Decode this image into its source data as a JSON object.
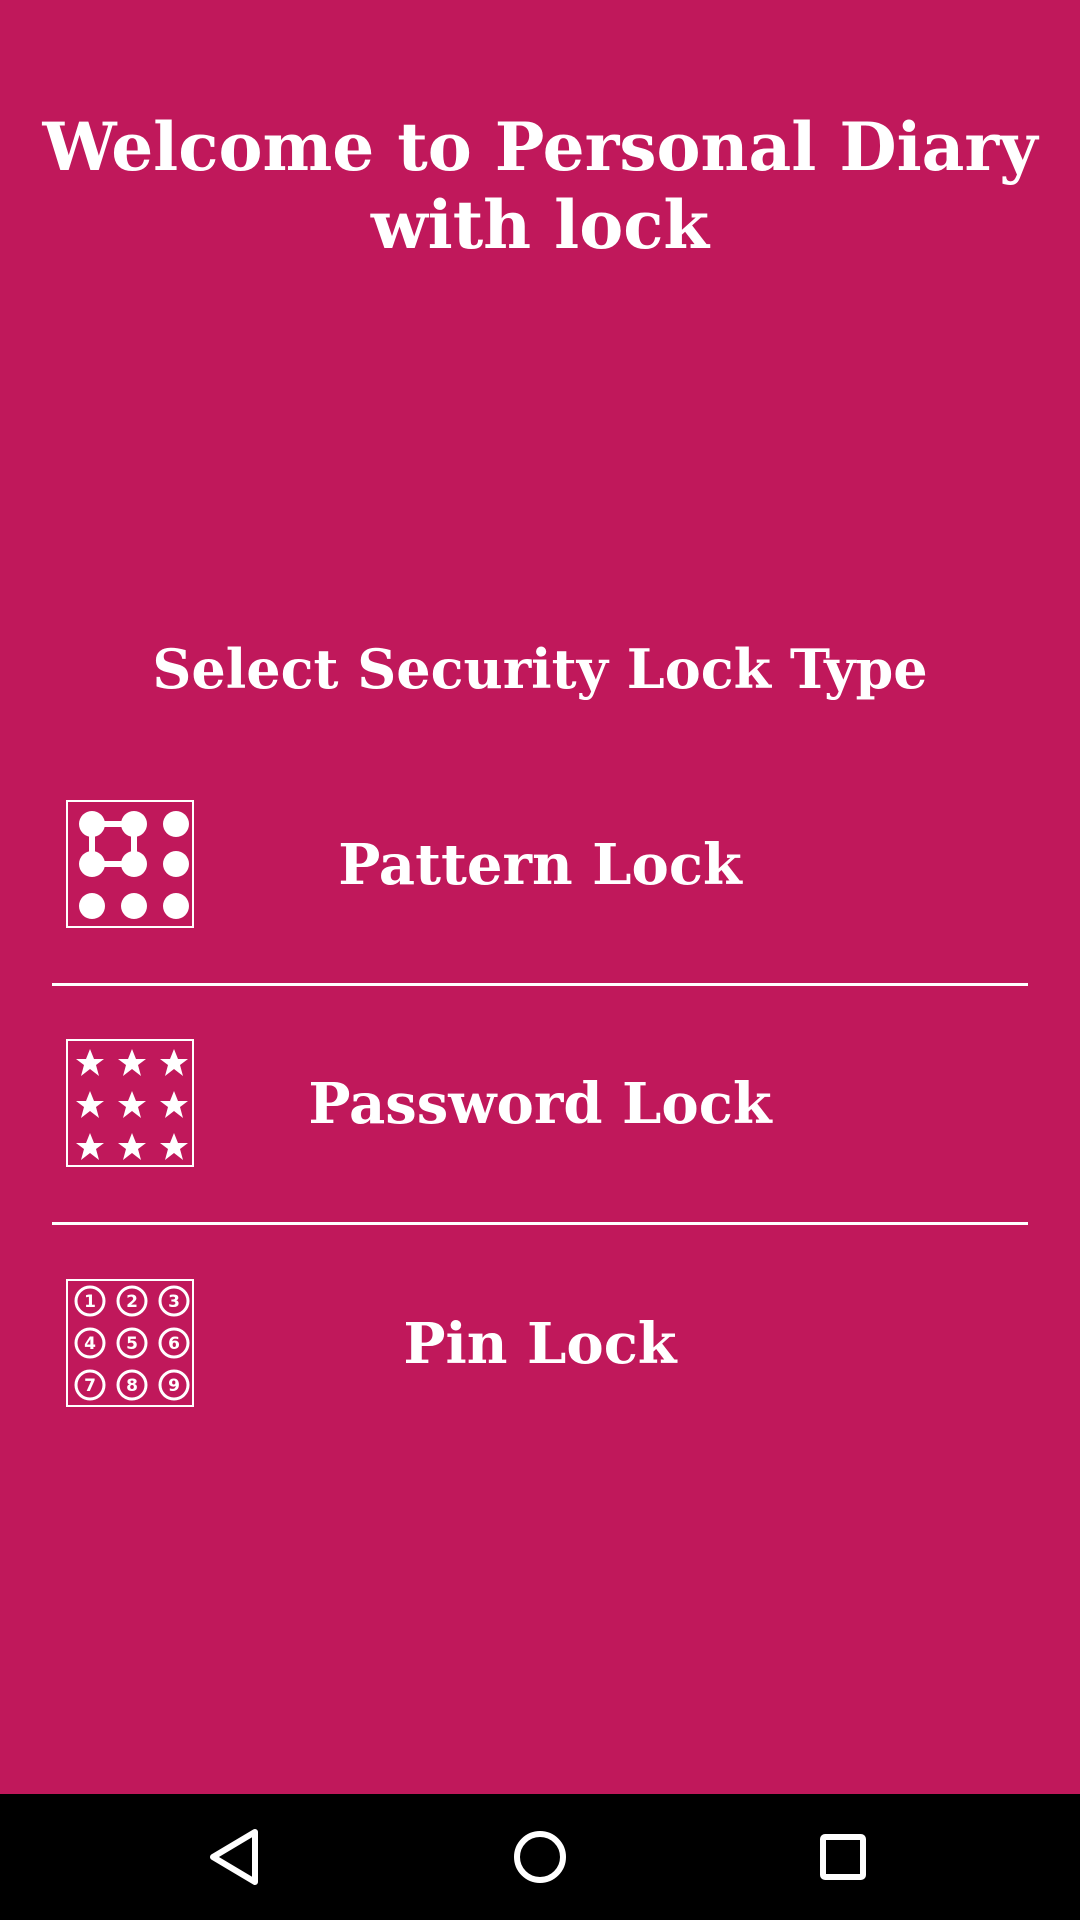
{
  "app": {
    "welcome_text": "Welcome to Personal Diary with lock",
    "section_title": "Select Security Lock Type",
    "background_color": "#c0185b"
  },
  "lock_options": [
    {
      "label": "Pattern Lock",
      "icon": "pattern-grid-icon"
    },
    {
      "label": "Password Lock",
      "icon": "asterisk-grid-icon"
    },
    {
      "label": "Pin Lock",
      "icon": "number-grid-icon",
      "digits": [
        "1",
        "2",
        "3",
        "4",
        "5",
        "6",
        "7",
        "8",
        "9"
      ]
    }
  ],
  "navbar": {
    "buttons": [
      "back-icon",
      "home-icon",
      "recent-apps-icon"
    ]
  }
}
